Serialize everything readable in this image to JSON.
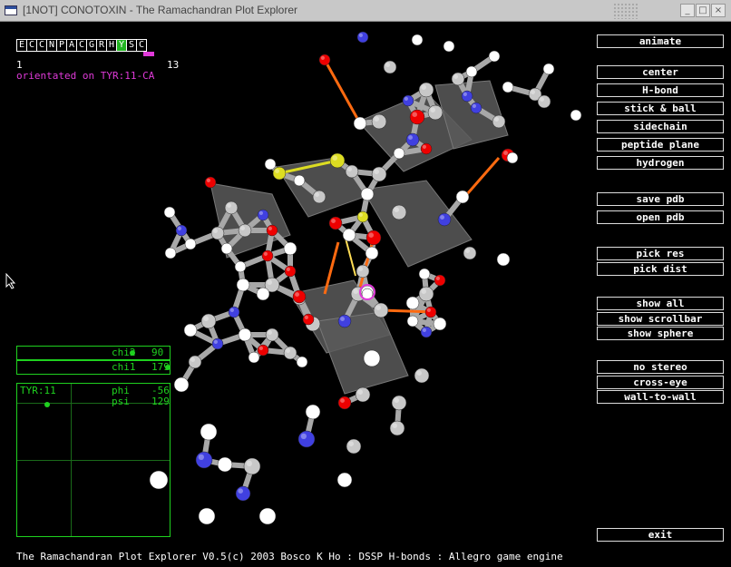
{
  "window": {
    "title": "[1NOT] CONOTOXIN - The Ramachandran Plot Explorer",
    "controls": [
      "_",
      "□",
      "×"
    ]
  },
  "sequence": {
    "residues": [
      "E",
      "C",
      "C",
      "N",
      "P",
      "A",
      "C",
      "G",
      "R",
      "H",
      "Y",
      "S",
      "C"
    ],
    "selected_index": 10,
    "start_label": "1",
    "end_label": "13",
    "orientation_text": "orientated on TYR:11-CA"
  },
  "buttons": {
    "animate": "animate",
    "center": "center",
    "hbond": "H-bond",
    "stick_ball": "stick & ball",
    "sidechain": "sidechain",
    "peptide_plane": "peptide plane",
    "hydrogen": "hydrogen",
    "save_pdb": "save pdb",
    "open_pdb": "open pdb",
    "pick_res": "pick res",
    "pick_dist": "pick dist",
    "show_all": "show all",
    "show_scrollbar": "show scrollbar",
    "show_sphere": "show sphere",
    "no_stereo": "no stereo",
    "cross_eye": "cross-eye",
    "wall_to_wall": "wall-to-wall",
    "exit": "exit"
  },
  "chi_panel": {
    "chi2_label": "chi2",
    "chi2_value": "90",
    "chi1_label": "chi1",
    "chi1_value": "179"
  },
  "rama_panel": {
    "residue": "TYR:11",
    "phi_label": "phi",
    "phi_value": "-56",
    "psi_label": "psi",
    "psi_value": "129",
    "phi": -56,
    "psi": 129
  },
  "status_bar": "The Ramachandran Plot Explorer V0.5(c) 2003 Bosco K Ho : DSSP H-bonds : Allegro game engine",
  "colors": {
    "accent_green": "#1fd11f",
    "selection_magenta": "#e03ad9",
    "oxygen": "#ee0000",
    "nitrogen": "#4040e0",
    "carbon": "#c8c8c8",
    "hydrogen": "#ffffff",
    "sulfur": "#dddd22",
    "hbond": "#ff6a10"
  }
}
